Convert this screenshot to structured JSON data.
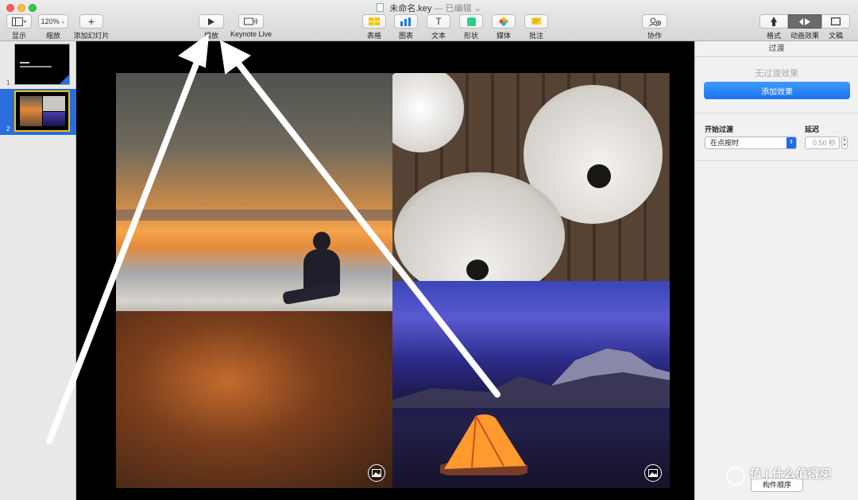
{
  "window": {
    "title": "未命名.key",
    "status": "— 已编辑",
    "status_chevron": "⌄"
  },
  "toolbar": {
    "view": {
      "label": "显示",
      "icon": "sidebar-icon"
    },
    "zoom": {
      "label": "缩放",
      "value": "120%"
    },
    "add_slide": {
      "label": "添加幻灯片",
      "icon": "plus-icon"
    },
    "play": {
      "label": "播放",
      "icon": "play-icon"
    },
    "keynote_live": {
      "label": "Keynote Live",
      "icon": "broadcast-icon"
    },
    "table": {
      "label": "表格",
      "icon": "table-icon",
      "color": "#f5c400"
    },
    "chart": {
      "label": "图表",
      "icon": "chart-icon",
      "color": "#1e78e8"
    },
    "text": {
      "label": "文本",
      "icon": "text-icon"
    },
    "shape": {
      "label": "形状",
      "icon": "shape-icon",
      "color": "#2ecc8b"
    },
    "media": {
      "label": "媒体",
      "icon": "media-icon"
    },
    "comment": {
      "label": "批注",
      "icon": "comment-icon",
      "color": "#f7d03a"
    },
    "collaborate": {
      "label": "协作",
      "icon": "collaborate-icon"
    },
    "format": {
      "label": "格式",
      "icon": "paintbrush-icon"
    },
    "animate": {
      "label": "动画效果",
      "icon": "animate-icon"
    },
    "document": {
      "label": "文稿",
      "icon": "document-icon"
    }
  },
  "navigator": {
    "slides": [
      {
        "number": "1",
        "selected": false
      },
      {
        "number": "2",
        "selected": true
      }
    ],
    "selection_color": "#2b6edb"
  },
  "inspector": {
    "header": "过渡",
    "no_effect": "无过渡效果",
    "add_effect": "添加效果",
    "start_label": "开始过渡",
    "start_value": "在点按时",
    "delay_label": "延迟",
    "delay_value": "0.50 秒",
    "bottom_button": "构件顺序"
  },
  "watermark": {
    "text": "值 | 什么值得买"
  },
  "colors": {
    "accent_blue": "#1a73f0",
    "annotation_arrow": "#ffffff"
  }
}
